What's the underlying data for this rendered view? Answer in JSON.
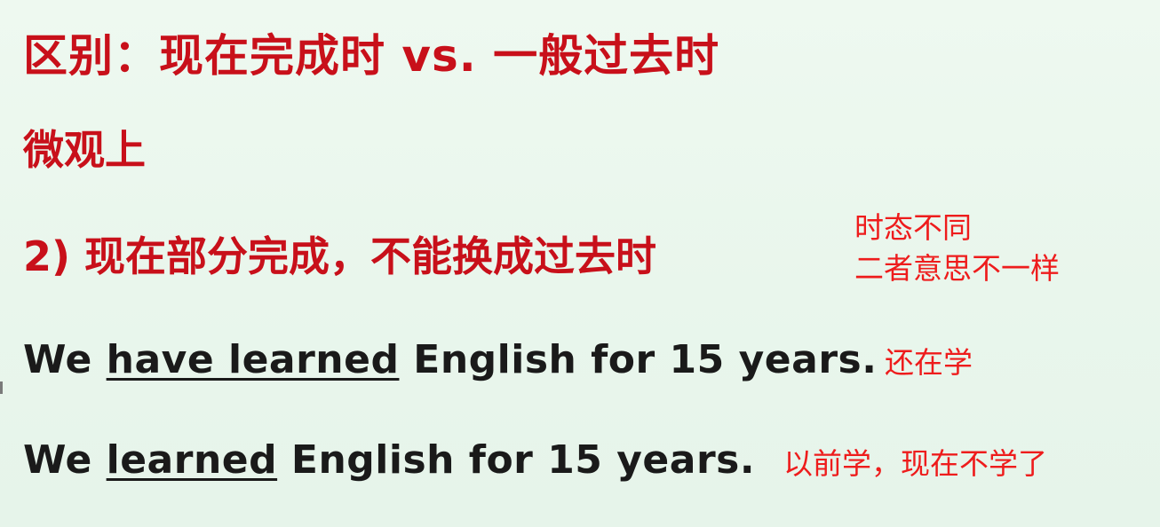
{
  "slide": {
    "title": "区别：现在完成时 vs. 一般过去时",
    "subtitle": "微观上",
    "point": "2) 现在部分完成，不能换成过去时",
    "sentences": [
      {
        "prefix": "We ",
        "underlined": "have learned",
        "suffix": " English for 15 years."
      },
      {
        "prefix": "We ",
        "underlined": "learned",
        "suffix": " English for 15 years."
      }
    ]
  },
  "annotations": {
    "tense_different": "时态不同",
    "meaning_different": "二者意思不一样",
    "still_learning": "还在学",
    "learned_before_not_now": "以前学，现在不学了"
  },
  "colors": {
    "background": "#ecf8ee",
    "slide_red": "#c8101a",
    "annotation_red": "#ee1c1c",
    "text_dark": "#1a1a1a"
  }
}
